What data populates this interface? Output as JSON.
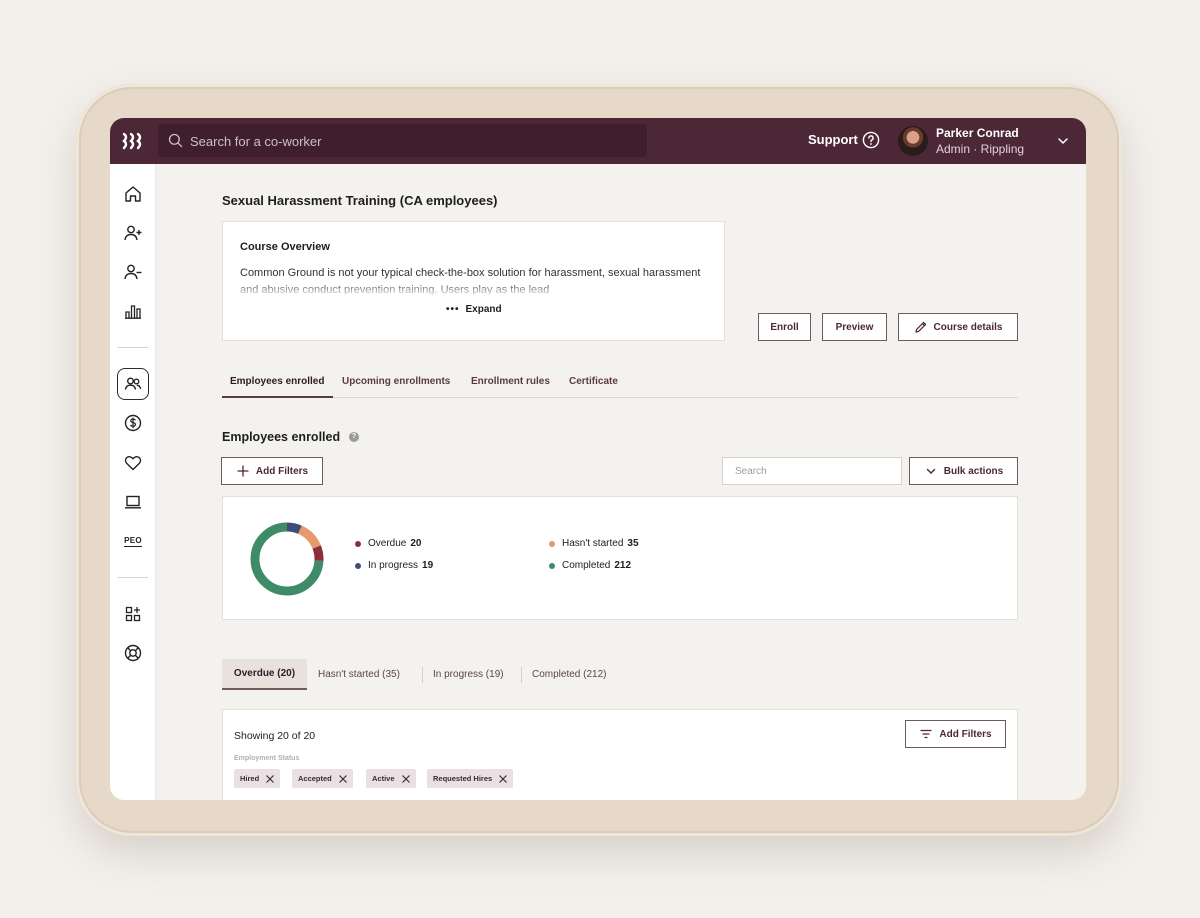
{
  "topbar": {
    "search_placeholder": "Search for a co-worker",
    "support_label": "Support",
    "user_name": "Parker Conrad",
    "user_role": "Admin · Rippling"
  },
  "page": {
    "title": "Sexual Harassment Training (CA employees)"
  },
  "overview": {
    "title": "Course Overview",
    "body": "Common Ground is not your typical check-the-box solution for harassment, sexual harassment and abusive conduct prevention training. Users play as the lead",
    "expand_label": "Expand"
  },
  "actions": {
    "enroll": "Enroll",
    "preview": "Preview",
    "course_details": "Course details"
  },
  "tabs": [
    {
      "label": "Employees enrolled",
      "active": true
    },
    {
      "label": "Upcoming enrollments",
      "active": false
    },
    {
      "label": "Enrollment rules",
      "active": false
    },
    {
      "label": "Certificate",
      "active": false
    }
  ],
  "enrolled": {
    "title": "Employees enrolled",
    "info": "?",
    "add_filters": "Add Filters",
    "search_placeholder": "Search",
    "bulk_actions": "Bulk actions"
  },
  "chart_data": {
    "type": "pie",
    "donut": true,
    "categories": [
      "Overdue",
      "Hasn't started",
      "In progress",
      "Completed"
    ],
    "values": [
      20,
      35,
      19,
      212
    ],
    "colors": [
      "#8e2c3c",
      "#e59a6b",
      "#3b4f7c",
      "#3f8b67"
    ]
  },
  "status_tabs": [
    {
      "label": "Overdue (20)",
      "active": true
    },
    {
      "label": "Hasn't started (35)",
      "active": false
    },
    {
      "label": "In progress (19)",
      "active": false
    },
    {
      "label": "Completed (212)",
      "active": false
    }
  ],
  "list": {
    "showing": "Showing 20 of 20",
    "add_filters": "Add Filters",
    "filter_group_label": "Employment Status",
    "chips": [
      "Hired",
      "Accepted",
      "Active",
      "Requested Hires"
    ]
  }
}
